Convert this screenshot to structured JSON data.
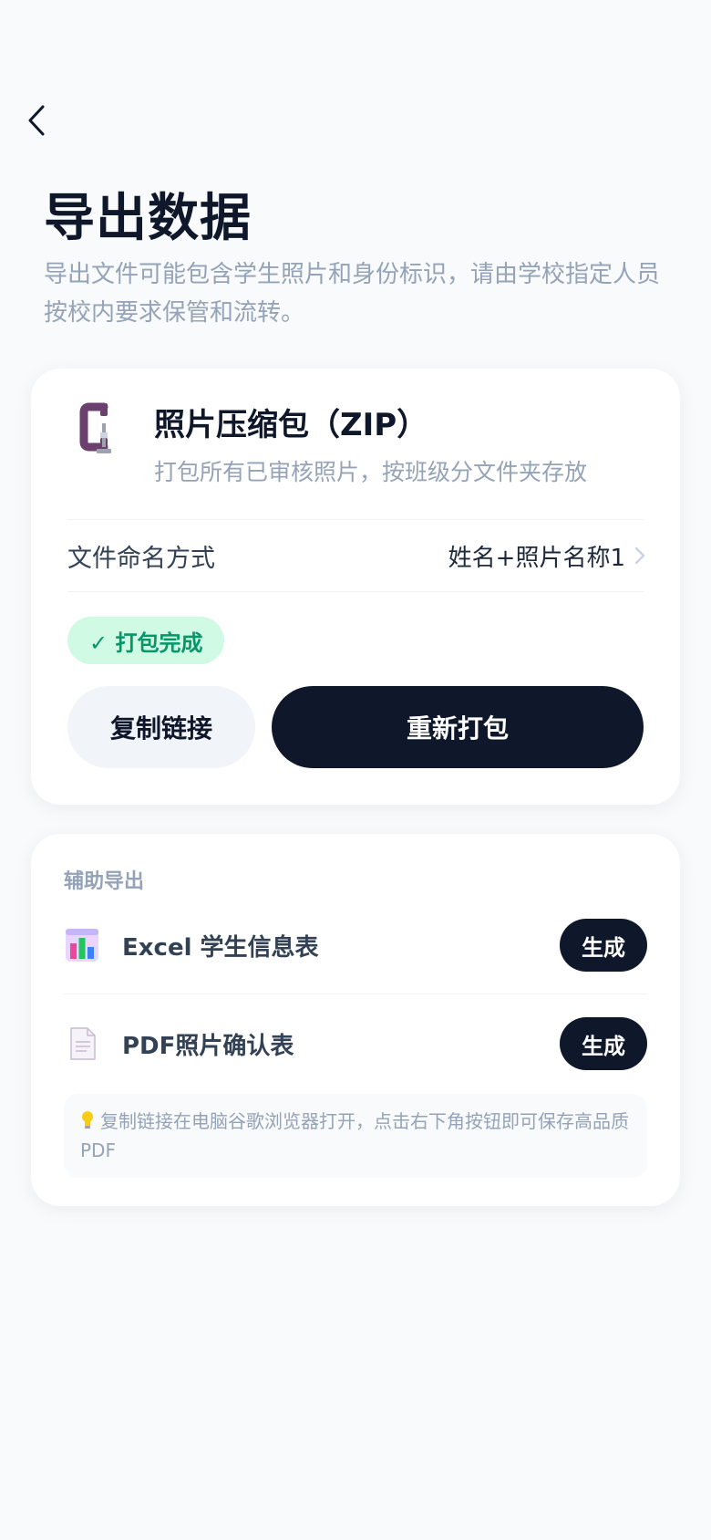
{
  "header": {
    "title": "导出数据",
    "subtitle": "导出文件可能包含学生照片和身份标识，请由学校指定人员按校内要求保管和流转。"
  },
  "zip_card": {
    "icon": "clamp-icon",
    "title": "照片压缩包（ZIP）",
    "description": "打包所有已审核照片，按班级分文件夹存放",
    "naming_label": "文件命名方式",
    "naming_value": "姓名+照片名称1",
    "status": "✓ 打包完成",
    "status_color": "#059669",
    "copy_label": "复制链接",
    "repack_label": "重新打包"
  },
  "aux_card": {
    "heading": "辅助导出",
    "items": [
      {
        "icon": "bar-chart-icon",
        "label": "Excel 学生信息表",
        "button": "生成"
      },
      {
        "icon": "document-icon",
        "label": "PDF照片确认表",
        "button": "生成"
      }
    ],
    "tip": "复制链接在电脑谷歌浏览器打开，点击右下角按钮即可保存高品质 PDF"
  },
  "colors": {
    "primary": "#0f172a",
    "muted": "#94a3b8",
    "success_bg": "#d1fae5",
    "background": "#f8fafc"
  }
}
